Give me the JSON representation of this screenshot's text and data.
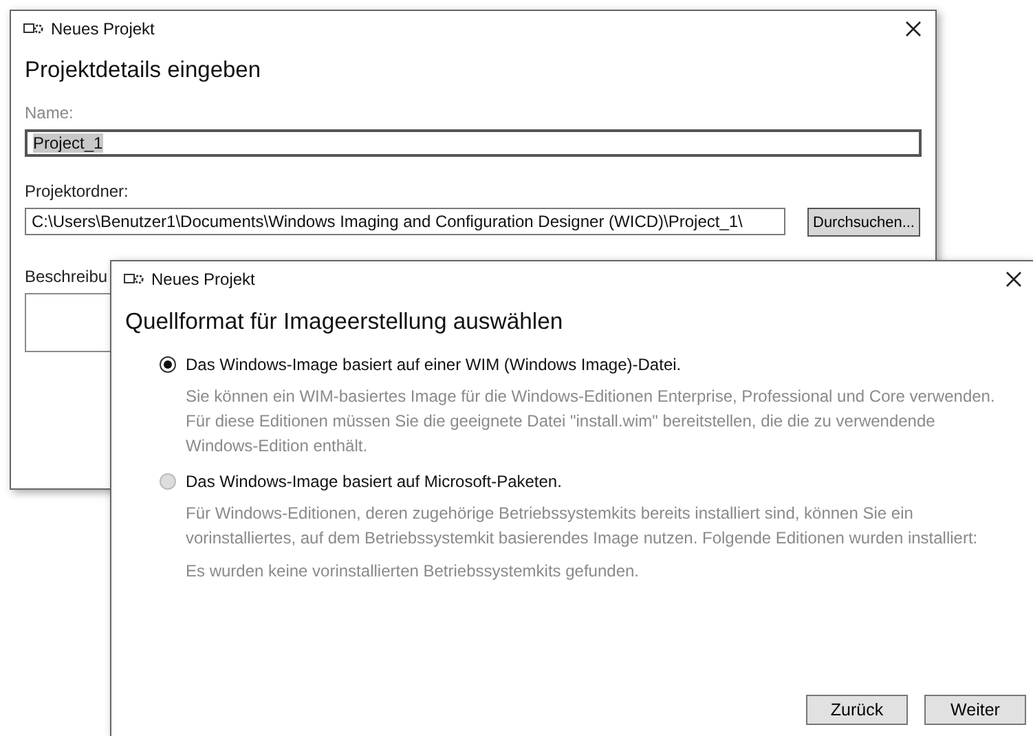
{
  "back_window": {
    "title": "Neues Projekt",
    "heading": "Projektdetails eingeben",
    "name_label": "Name:",
    "name_value": "Project_1",
    "name_text_selected": true,
    "folder_label": "Projektordner:",
    "folder_value": "C:\\Users\\Benutzer1\\Documents\\Windows Imaging and Configuration Designer (WICD)\\Project_1\\",
    "browse_button": "Durchsuchen...",
    "description_label": "Beschreibu"
  },
  "front_window": {
    "title": "Neues Projekt",
    "heading": "Quellformat für Imageerstellung auswählen",
    "options": [
      {
        "label": "Das Windows-Image basiert auf einer WIM (Windows Image)-Datei.",
        "selected": true,
        "disabled": false,
        "paragraphs": [
          "Sie können ein WIM-basiertes Image für die Windows-Editionen Enterprise, Professional und Core verwenden. Für diese Editionen müssen Sie die geeignete Datei \"install.wim\" bereitstellen, die die zu verwendende Windows-Edition enthält."
        ]
      },
      {
        "label": "Das Windows-Image basiert auf Microsoft-Paketen.",
        "selected": false,
        "disabled": true,
        "paragraphs": [
          "Für Windows-Editionen, deren zugehörige Betriebssystemkits bereits installiert sind, können Sie ein vorinstalliertes, auf dem Betriebssystemkit basierendes Image nutzen. Folgende Editionen wurden installiert:",
          "Es wurden keine vorinstallierten Betriebssystemkits gefunden."
        ]
      }
    ],
    "buttons": [
      "Zurück",
      "Weiter"
    ]
  }
}
